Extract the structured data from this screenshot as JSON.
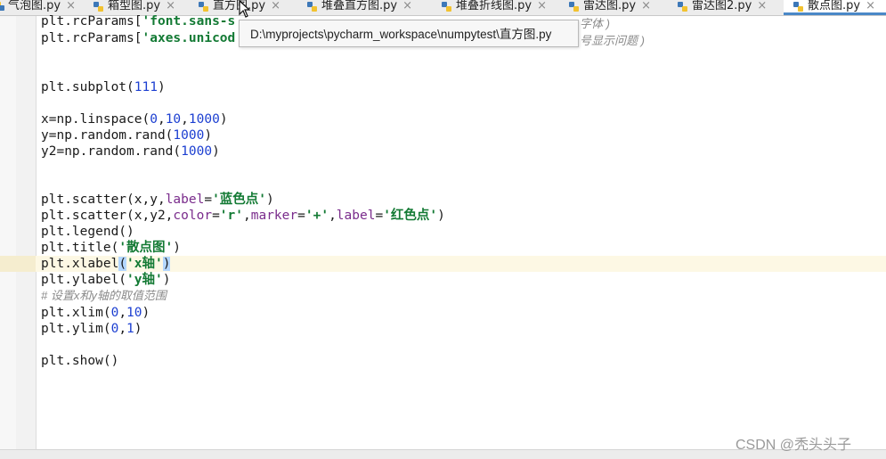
{
  "tabs": [
    {
      "label": "气泡图.py",
      "active": false
    },
    {
      "label": "箱型图.py",
      "active": false
    },
    {
      "label": "直方图.py",
      "active": false
    },
    {
      "label": "堆叠直方图.py",
      "active": false
    },
    {
      "label": "堆叠折线图.py",
      "active": false
    },
    {
      "label": "雷达图.py",
      "active": false
    },
    {
      "label": "雷达图2.py",
      "active": false
    },
    {
      "label": "散点图.py",
      "active": true
    }
  ],
  "tab_close_glyph": "×",
  "tooltip": {
    "path": "D:\\myprojects\\pycharm_workspace\\numpytest\\直方图.py"
  },
  "partial": {
    "comment_tail_1": "字体 )",
    "comment_tail_2": "号显示问题 )"
  },
  "code": {
    "l1_obj": "plt.rcParams[",
    "l1_str": "'font.sans-s",
    "l2_obj": "plt.rcParams[",
    "l2_str": "'axes.unicod",
    "l3": "plt.subplot(",
    "l3_num": "111",
    "l3_end": ")",
    "l4_a": "x=np.linspace(",
    "l4_n1": "0",
    "l4_c1": ",",
    "l4_n2": "10",
    "l4_c2": ",",
    "l4_n3": "1000",
    "l4_end": ")",
    "l5_a": "y=np.random.rand(",
    "l5_n": "1000",
    "l5_end": ")",
    "l6_a": "y2=np.random.rand(",
    "l6_n": "1000",
    "l6_end": ")",
    "l7_a": "plt.scatter(x,y,",
    "l7_k": "label",
    "l7_eq": "=",
    "l7_s": "'蓝色点'",
    "l7_end": ")",
    "l8_a": "plt.scatter(x,y2,",
    "l8_k1": "color",
    "l8_eq1": "=",
    "l8_s1": "'r'",
    "l8_c1": ",",
    "l8_k2": "marker",
    "l8_eq2": "=",
    "l8_s2": "'+'",
    "l8_c2": ",",
    "l8_k3": "label",
    "l8_eq3": "=",
    "l8_s3": "'红色点'",
    "l8_end": ")",
    "l9": "plt.legend()",
    "l10_a": "plt.title(",
    "l10_s": "'散点图'",
    "l10_end": ")",
    "l11_a": "plt.xlabel",
    "l11_p1": "(",
    "l11_s": "'x轴'",
    "l11_p2": ")",
    "l12_a": "plt.ylabel(",
    "l12_s": "'y轴'",
    "l12_end": ")",
    "l13_comment": "# 设置x和y轴的取值范围",
    "l14_a": "plt.xlim(",
    "l14_n1": "0",
    "l14_c": ",",
    "l14_n2": "10",
    "l14_end": ")",
    "l15_a": "plt.ylim(",
    "l15_n1": "0",
    "l15_c": ",",
    "l15_n2": "1",
    "l15_end": ")",
    "l16": "plt.show()"
  },
  "watermark": "CSDN @秃头头子",
  "colors": {
    "string": "#137a34",
    "number": "#1c3fd1",
    "kwarg": "#7a2c8c",
    "comment": "#8a8a8a",
    "active_tab_underline": "#4a88c7"
  }
}
